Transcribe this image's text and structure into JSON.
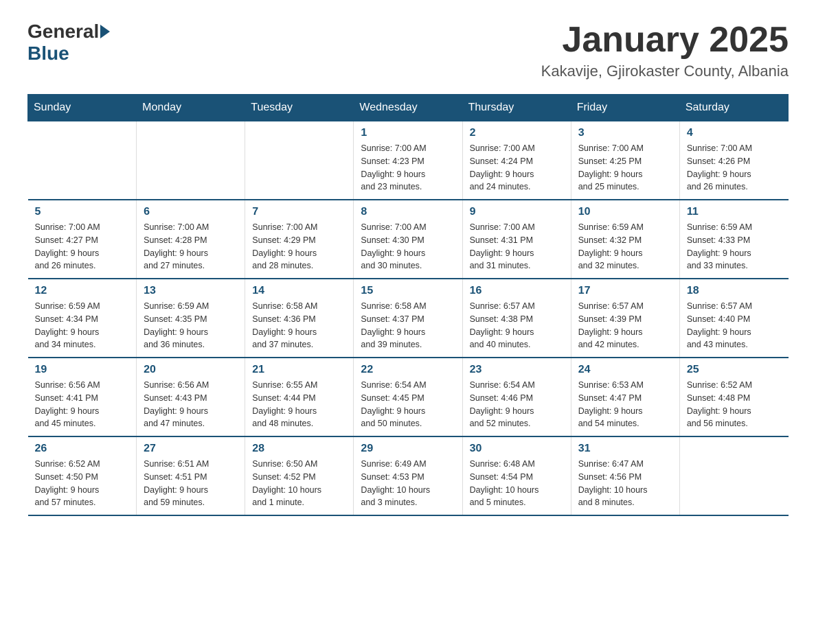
{
  "header": {
    "logo_general": "General",
    "logo_blue": "Blue",
    "month_title": "January 2025",
    "location": "Kakavije, Gjirokaster County, Albania"
  },
  "days_of_week": [
    "Sunday",
    "Monday",
    "Tuesday",
    "Wednesday",
    "Thursday",
    "Friday",
    "Saturday"
  ],
  "weeks": [
    [
      {
        "day": "",
        "info": ""
      },
      {
        "day": "",
        "info": ""
      },
      {
        "day": "",
        "info": ""
      },
      {
        "day": "1",
        "info": "Sunrise: 7:00 AM\nSunset: 4:23 PM\nDaylight: 9 hours\nand 23 minutes."
      },
      {
        "day": "2",
        "info": "Sunrise: 7:00 AM\nSunset: 4:24 PM\nDaylight: 9 hours\nand 24 minutes."
      },
      {
        "day": "3",
        "info": "Sunrise: 7:00 AM\nSunset: 4:25 PM\nDaylight: 9 hours\nand 25 minutes."
      },
      {
        "day": "4",
        "info": "Sunrise: 7:00 AM\nSunset: 4:26 PM\nDaylight: 9 hours\nand 26 minutes."
      }
    ],
    [
      {
        "day": "5",
        "info": "Sunrise: 7:00 AM\nSunset: 4:27 PM\nDaylight: 9 hours\nand 26 minutes."
      },
      {
        "day": "6",
        "info": "Sunrise: 7:00 AM\nSunset: 4:28 PM\nDaylight: 9 hours\nand 27 minutes."
      },
      {
        "day": "7",
        "info": "Sunrise: 7:00 AM\nSunset: 4:29 PM\nDaylight: 9 hours\nand 28 minutes."
      },
      {
        "day": "8",
        "info": "Sunrise: 7:00 AM\nSunset: 4:30 PM\nDaylight: 9 hours\nand 30 minutes."
      },
      {
        "day": "9",
        "info": "Sunrise: 7:00 AM\nSunset: 4:31 PM\nDaylight: 9 hours\nand 31 minutes."
      },
      {
        "day": "10",
        "info": "Sunrise: 6:59 AM\nSunset: 4:32 PM\nDaylight: 9 hours\nand 32 minutes."
      },
      {
        "day": "11",
        "info": "Sunrise: 6:59 AM\nSunset: 4:33 PM\nDaylight: 9 hours\nand 33 minutes."
      }
    ],
    [
      {
        "day": "12",
        "info": "Sunrise: 6:59 AM\nSunset: 4:34 PM\nDaylight: 9 hours\nand 34 minutes."
      },
      {
        "day": "13",
        "info": "Sunrise: 6:59 AM\nSunset: 4:35 PM\nDaylight: 9 hours\nand 36 minutes."
      },
      {
        "day": "14",
        "info": "Sunrise: 6:58 AM\nSunset: 4:36 PM\nDaylight: 9 hours\nand 37 minutes."
      },
      {
        "day": "15",
        "info": "Sunrise: 6:58 AM\nSunset: 4:37 PM\nDaylight: 9 hours\nand 39 minutes."
      },
      {
        "day": "16",
        "info": "Sunrise: 6:57 AM\nSunset: 4:38 PM\nDaylight: 9 hours\nand 40 minutes."
      },
      {
        "day": "17",
        "info": "Sunrise: 6:57 AM\nSunset: 4:39 PM\nDaylight: 9 hours\nand 42 minutes."
      },
      {
        "day": "18",
        "info": "Sunrise: 6:57 AM\nSunset: 4:40 PM\nDaylight: 9 hours\nand 43 minutes."
      }
    ],
    [
      {
        "day": "19",
        "info": "Sunrise: 6:56 AM\nSunset: 4:41 PM\nDaylight: 9 hours\nand 45 minutes."
      },
      {
        "day": "20",
        "info": "Sunrise: 6:56 AM\nSunset: 4:43 PM\nDaylight: 9 hours\nand 47 minutes."
      },
      {
        "day": "21",
        "info": "Sunrise: 6:55 AM\nSunset: 4:44 PM\nDaylight: 9 hours\nand 48 minutes."
      },
      {
        "day": "22",
        "info": "Sunrise: 6:54 AM\nSunset: 4:45 PM\nDaylight: 9 hours\nand 50 minutes."
      },
      {
        "day": "23",
        "info": "Sunrise: 6:54 AM\nSunset: 4:46 PM\nDaylight: 9 hours\nand 52 minutes."
      },
      {
        "day": "24",
        "info": "Sunrise: 6:53 AM\nSunset: 4:47 PM\nDaylight: 9 hours\nand 54 minutes."
      },
      {
        "day": "25",
        "info": "Sunrise: 6:52 AM\nSunset: 4:48 PM\nDaylight: 9 hours\nand 56 minutes."
      }
    ],
    [
      {
        "day": "26",
        "info": "Sunrise: 6:52 AM\nSunset: 4:50 PM\nDaylight: 9 hours\nand 57 minutes."
      },
      {
        "day": "27",
        "info": "Sunrise: 6:51 AM\nSunset: 4:51 PM\nDaylight: 9 hours\nand 59 minutes."
      },
      {
        "day": "28",
        "info": "Sunrise: 6:50 AM\nSunset: 4:52 PM\nDaylight: 10 hours\nand 1 minute."
      },
      {
        "day": "29",
        "info": "Sunrise: 6:49 AM\nSunset: 4:53 PM\nDaylight: 10 hours\nand 3 minutes."
      },
      {
        "day": "30",
        "info": "Sunrise: 6:48 AM\nSunset: 4:54 PM\nDaylight: 10 hours\nand 5 minutes."
      },
      {
        "day": "31",
        "info": "Sunrise: 6:47 AM\nSunset: 4:56 PM\nDaylight: 10 hours\nand 8 minutes."
      },
      {
        "day": "",
        "info": ""
      }
    ]
  ]
}
